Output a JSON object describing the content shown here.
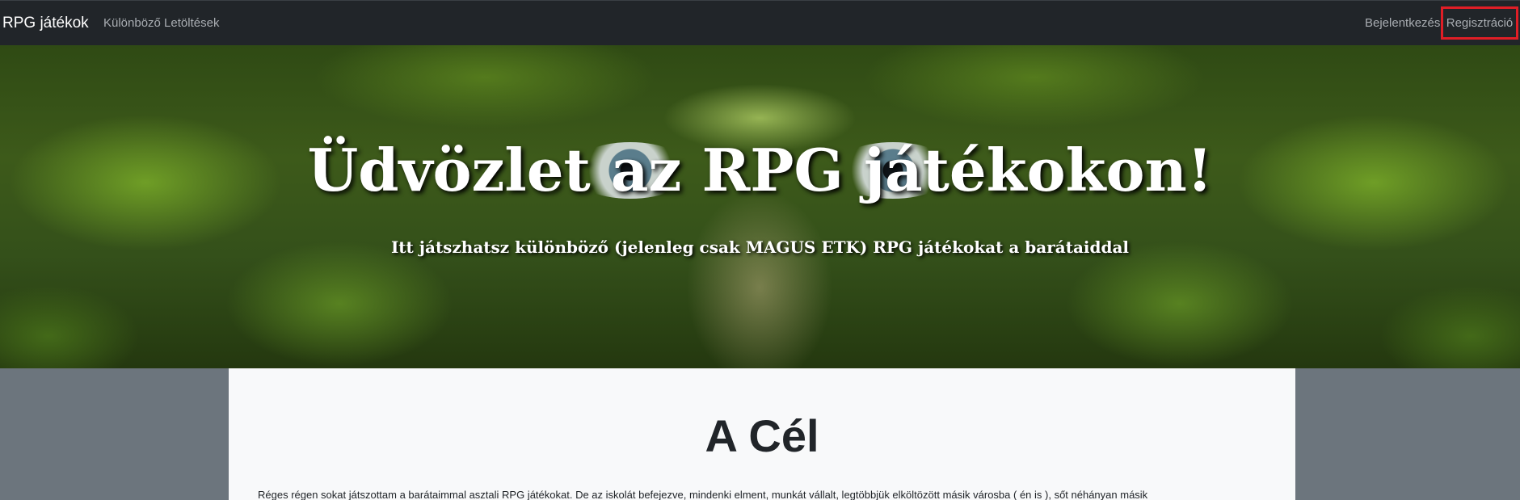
{
  "navbar": {
    "brand": "RPG játékok",
    "links": {
      "downloads": "Különböző Letöltések",
      "login": "Bejelentkezés",
      "register": "Regisztráció"
    },
    "highlight_color": "#e01e26"
  },
  "hero": {
    "title": "Üdvözlet az RPG játékokon!",
    "subtitle": "Itt játszhatsz különböző (jelenleg csak MAGUS ETK) RPG játékokat a barátaiddal"
  },
  "content": {
    "heading": "A Cél",
    "paragraph": "Réges régen sokat játszottam a barátaimmal asztali RPG játékokat. De az iskolát befejezve, mindenki elment, munkát vállalt, legtöbbjük elköltözött másik városba ( én is ), sőt néhányan másik"
  }
}
